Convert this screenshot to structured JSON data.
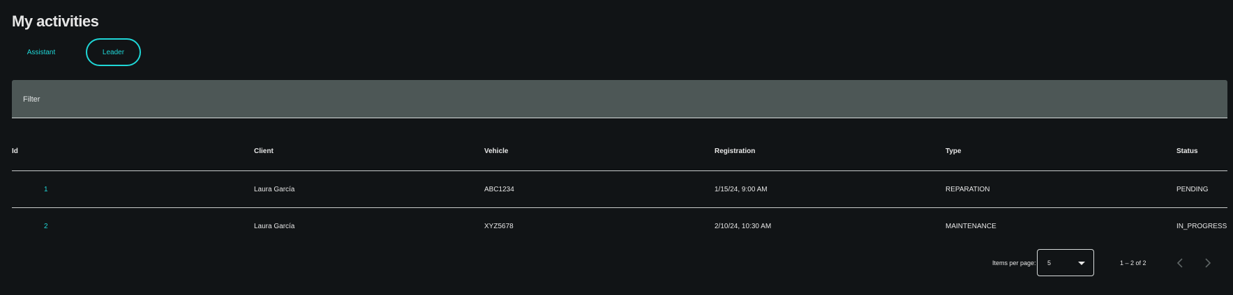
{
  "page": {
    "title": "My activities"
  },
  "tabs": [
    {
      "label": "Assistant",
      "selected": false
    },
    {
      "label": "Leader",
      "selected": true
    }
  ],
  "filter": {
    "label": "Filter"
  },
  "table": {
    "headers": {
      "id": "Id",
      "client": "Client",
      "vehicle": "Vehicle",
      "registration": "Registration",
      "type": "Type",
      "status": "Status"
    },
    "rows": [
      {
        "id": "1",
        "client": "Laura García",
        "vehicle": "ABC1234",
        "registration": "1/15/24, 9:00 AM",
        "type": "REPARATION",
        "status": "PENDING"
      },
      {
        "id": "2",
        "client": "Laura García",
        "vehicle": "XYZ5678",
        "registration": "2/10/24, 10:30 AM",
        "type": "MAINTENANCE",
        "status": "IN_PROGRESS"
      }
    ]
  },
  "paginator": {
    "items_per_page_label": "Items per page:",
    "items_per_page_value": "5",
    "range_label": "1 – 2 of 2",
    "prev_icon": "chevron-left-icon",
    "next_icon": "chevron-right-icon",
    "dropdown_icon": "caret-down-icon"
  },
  "colors": {
    "background": "#111416",
    "accent": "#1fd7d7",
    "filter_bar": "#4d5756",
    "text": "#e6e6e6",
    "disabled": "#5f6666"
  }
}
